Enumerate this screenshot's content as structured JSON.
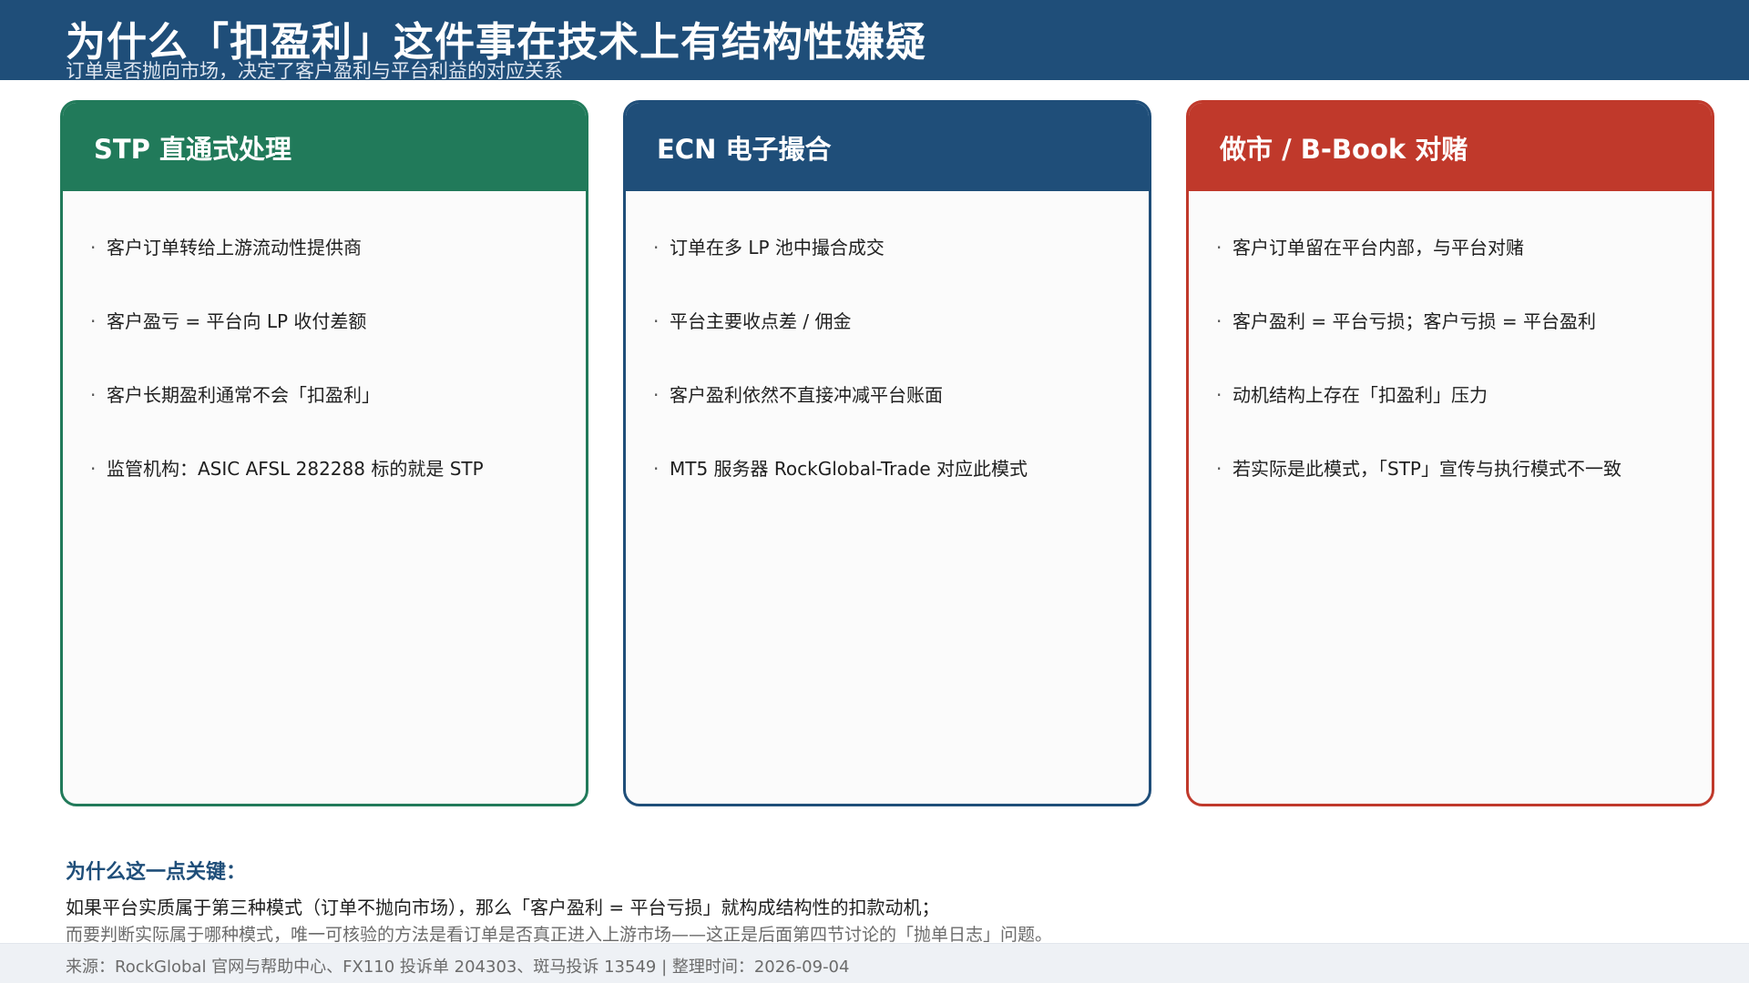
{
  "header": {
    "title": "为什么「扣盈利」这件事在技术上有结构性嫌疑",
    "subtitle": "订单是否抛向市场，决定了客户盈利与平台利益的对应关系"
  },
  "cards": [
    {
      "title": "STP 直通式处理",
      "color": "#217a5a",
      "items": [
        "客户订单转给上游流动性提供商",
        "客户盈亏 = 平台向 LP 收付差额",
        "客户长期盈利通常不会「扣盈利」",
        "监管机构：ASIC AFSL 282288 标的就是 STP"
      ]
    },
    {
      "title": "ECN 电子撮合",
      "color": "#1f4e79",
      "items": [
        "订单在多 LP 池中撮合成交",
        "平台主要收点差 / 佣金",
        "客户盈利依然不直接冲减平台账面",
        "MT5 服务器 RockGlobal-Trade 对应此模式"
      ]
    },
    {
      "title": "做市 / B-Book 对赌",
      "color": "#c0392b",
      "items": [
        "客户订单留在平台内部，与平台对赌",
        "客户盈利 = 平台亏损；客户亏损 = 平台盈利",
        "动机结构上存在「扣盈利」压力",
        "若实际是此模式，「STP」宣传与执行模式不一致"
      ]
    }
  ],
  "bullet_symbol": "·",
  "key_note": {
    "title": "为什么这一点关键：",
    "line1": "如果平台实质属于第三种模式（订单不抛向市场），那么「客户盈利 = 平台亏损」就构成结构性的扣款动机；",
    "line2": "而要判断实际属于哪种模式，唯一可核验的方法是看订单是否真正进入上游市场——这正是后面第四节讨论的「抛单日志」问题。"
  },
  "footer": {
    "source": "来源：RockGlobal 官网与帮助中心、FX110 投诉单 204303、斑马投诉 13549  |  整理时间：2026-09-04"
  }
}
